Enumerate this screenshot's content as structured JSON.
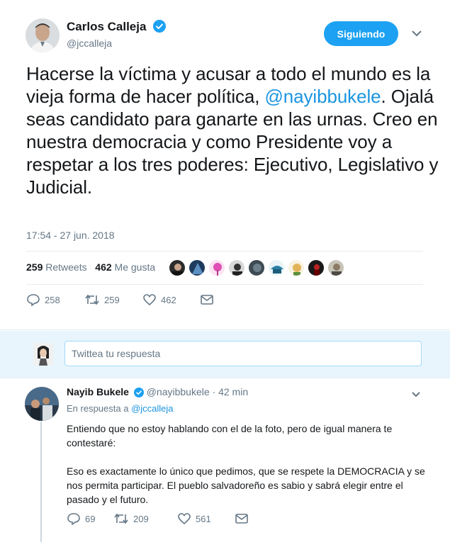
{
  "tweet": {
    "author_name": "Carlos Calleja",
    "author_handle": "@jccalleja",
    "follow_label": "Siguiendo",
    "text_before": "Hacerse la víctima y acusar a todo el mundo es la vieja forma de hacer política, ",
    "mention": "@nayibbukele",
    "text_after": ". Ojalá seas candidato para ganarte en las urnas. Creo en nuestra democracia y como Presidente voy a respetar a los tres poderes: Ejecutivo, Legislativo y Judicial.",
    "timestamp": "17:54 - 27 jun. 2018",
    "retweets_count": "259",
    "retweets_label": "Retweets",
    "likes_count": "462",
    "likes_label": "Me gusta",
    "reply_count": "258",
    "retweet_action_count": "259",
    "like_action_count": "462"
  },
  "reply_box": {
    "placeholder": "Twittea tu respuesta"
  },
  "reply": {
    "author_name": "Nayib Bukele",
    "author_handle": "@nayibbukele",
    "time": "· 42 min",
    "in_reply_prefix": "En respuesta a",
    "in_reply_handle": "@jccalleja",
    "paragraph1": "Entiendo que no estoy hablando con el de la foto, pero de igual manera te contestaré:",
    "paragraph2": "Eso es exactamente lo único que pedimos, que se respete la DEMOCRACIA y se nos permita participar. El pueblo salvadoreño es sabio y sabrá elegir entre el pasado y el futuro.",
    "reply_count": "69",
    "retweet_count": "209",
    "like_count": "561"
  },
  "colors": {
    "accent": "#1da1f2",
    "link": "#1b95e0",
    "secondary_text": "#657786",
    "reply_bg": "#e8f5fd"
  }
}
